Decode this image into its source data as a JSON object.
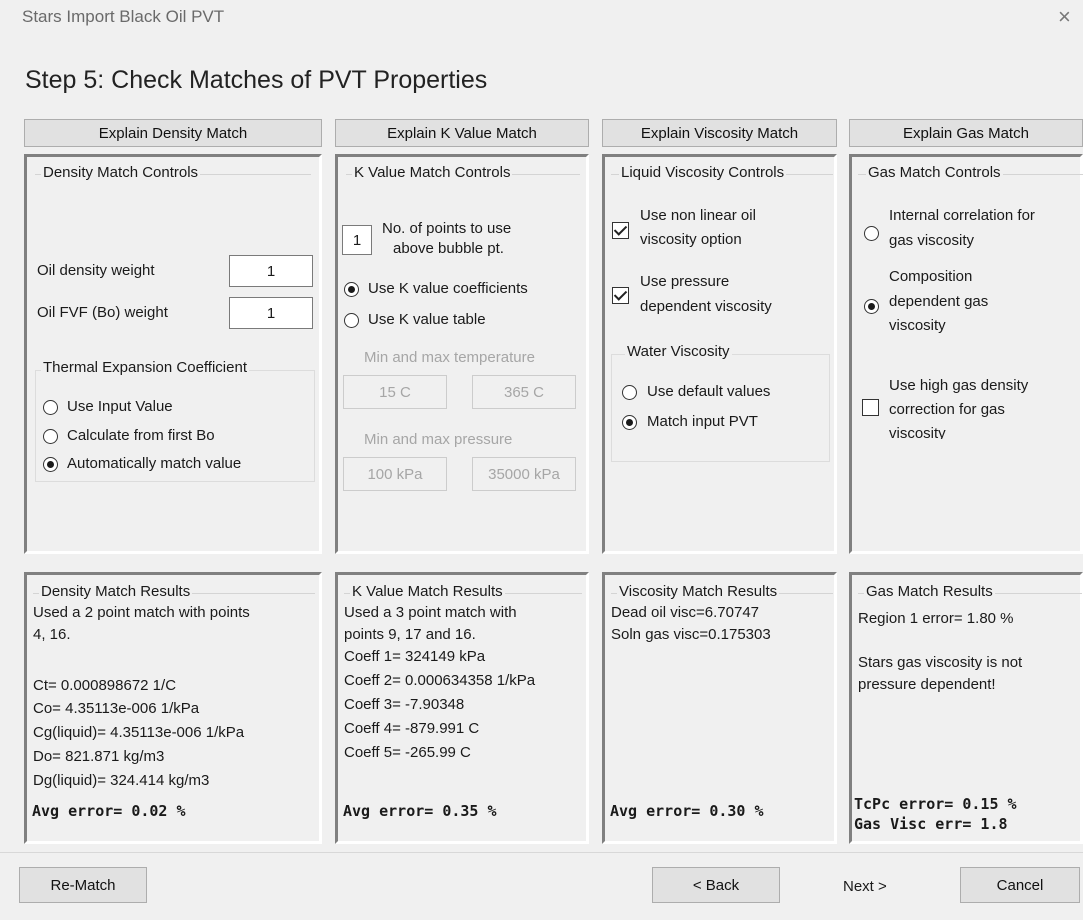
{
  "window": {
    "title": "Stars Import Black Oil PVT",
    "close_glyph": "×"
  },
  "heading": "Step 5: Check Matches of PVT Properties",
  "explain_buttons": [
    "Explain Density Match",
    "Explain K Value Match",
    "Explain Viscosity Match",
    "Explain Gas Match"
  ],
  "density_controls": {
    "title": "Density Match Controls",
    "oil_density_label": "Oil density weight",
    "oil_density_value": "1",
    "fvf_label": "Oil FVF (Bo) weight",
    "fvf_value": "1",
    "thermal": {
      "title": "Thermal Expansion Coefficient",
      "options": [
        "Use Input Value",
        "Calculate from first Bo",
        "Automatically match value"
      ],
      "selected": "Automatically match value"
    }
  },
  "kvalue_controls": {
    "title": "K Value Match Controls",
    "points_value": "1",
    "points_label_1": "No. of points to use",
    "points_label_2": "above bubble pt.",
    "options": [
      "Use K value coefficients",
      "Use K value table"
    ],
    "selected": "Use K value coefficients",
    "temp_label": "Min and max temperature",
    "temp_min": "15 C",
    "temp_max": "365 C",
    "pressure_label": "Min and max pressure",
    "pressure_min": "100 kPa",
    "pressure_max": "35000 kPa"
  },
  "viscosity_controls": {
    "title": "Liquid Viscosity Controls",
    "nonlinear_1": "Use non linear oil",
    "nonlinear_2": "viscosity option",
    "nonlinear_checked": true,
    "pressure_1": "Use pressure",
    "pressure_2": "dependent viscosity",
    "pressure_checked": true,
    "water": {
      "title": "Water Viscosity",
      "options": [
        "Use default values",
        "Match input PVT"
      ],
      "selected": "Match input PVT"
    }
  },
  "gas_controls": {
    "title": "Gas Match Controls",
    "internal_1": "Internal correlation for",
    "internal_2": "gas viscosity",
    "composition_1": "Composition",
    "composition_2": "dependent gas",
    "composition_3": "viscosity",
    "selected": "Composition dependent gas viscosity",
    "high_density_1": "Use high gas density",
    "high_density_2": "correction for gas",
    "high_density_3": "viscosity",
    "high_density_checked": false
  },
  "density_results": {
    "title": "Density Match Results",
    "lines": [
      "Used a 2 point match with points",
      "4, 16.",
      "",
      "Ct= 0.000898672 1/C",
      "Co= 4.35113e-006 1/kPa",
      "Cg(liquid)= 4.35113e-006 1/kPa",
      "Do= 821.871 kg/m3",
      "Dg(liquid)= 324.414 kg/m3"
    ],
    "avg_error": "Avg error= 0.02 %"
  },
  "kvalue_results": {
    "title": "K Value Match Results",
    "lines": [
      "Used a 3 point match with",
      "points 9, 17 and 16.",
      "Coeff 1= 324149 kPa",
      "Coeff 2= 0.000634358 1/kPa",
      "Coeff 3= -7.90348",
      "Coeff 4= -879.991 C",
      "Coeff 5= -265.99 C"
    ],
    "avg_error": "Avg error= 0.35 %"
  },
  "viscosity_results": {
    "title": "Viscosity Match Results",
    "lines": [
      "Dead oil visc=6.70747",
      "Soln gas visc=0.175303"
    ],
    "avg_error": "Avg error= 0.30 %"
  },
  "gas_results": {
    "title": "Gas Match Results",
    "lines": [
      "Region 1 error= 1.80 %",
      "",
      "Stars gas viscosity is not",
      "pressure dependent!"
    ],
    "error_1": "TcPc error= 0.15 %",
    "error_2": "Gas Visc err= 1.8"
  },
  "footer": {
    "rematch": "Re-Match",
    "back": "< Back",
    "next": "Next >",
    "cancel": "Cancel"
  }
}
